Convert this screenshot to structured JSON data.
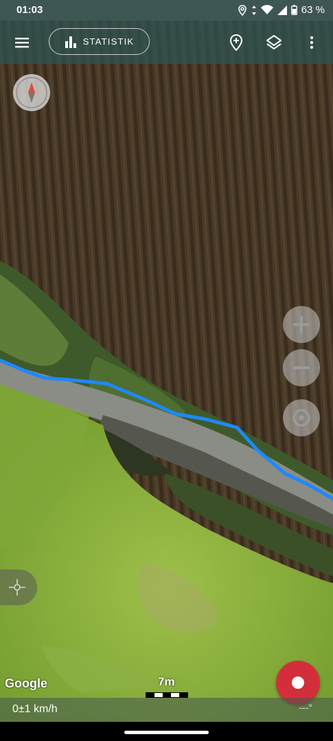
{
  "status_bar": {
    "time": "01:03",
    "battery": "63 %",
    "icons": [
      "location-icon",
      "data-arrows-icon",
      "wifi-icon",
      "signal-icon",
      "battery-icon"
    ]
  },
  "toolbar": {
    "menu_icon": "hamburger-menu-icon",
    "stat_label": "STATISTIK",
    "stat_icon": "bar-chart-icon",
    "add_marker_icon": "add-location-icon",
    "layers_icon": "layers-icon",
    "more_icon": "more-vertical-icon"
  },
  "map": {
    "attribution": "Google",
    "scale_label": "7m",
    "track_color": "#1e88ff"
  },
  "controls": {
    "zoom_in_icon": "plus-icon",
    "zoom_out_icon": "minus-icon",
    "center_icon": "target-icon",
    "compass_icon": "compass-icon",
    "locate_icon": "crosshair-icon",
    "record_icon": "record-icon",
    "record_color": "#d32f3b"
  },
  "bottom_bar": {
    "speed": "0±1 km/h",
    "heading": "---°"
  }
}
